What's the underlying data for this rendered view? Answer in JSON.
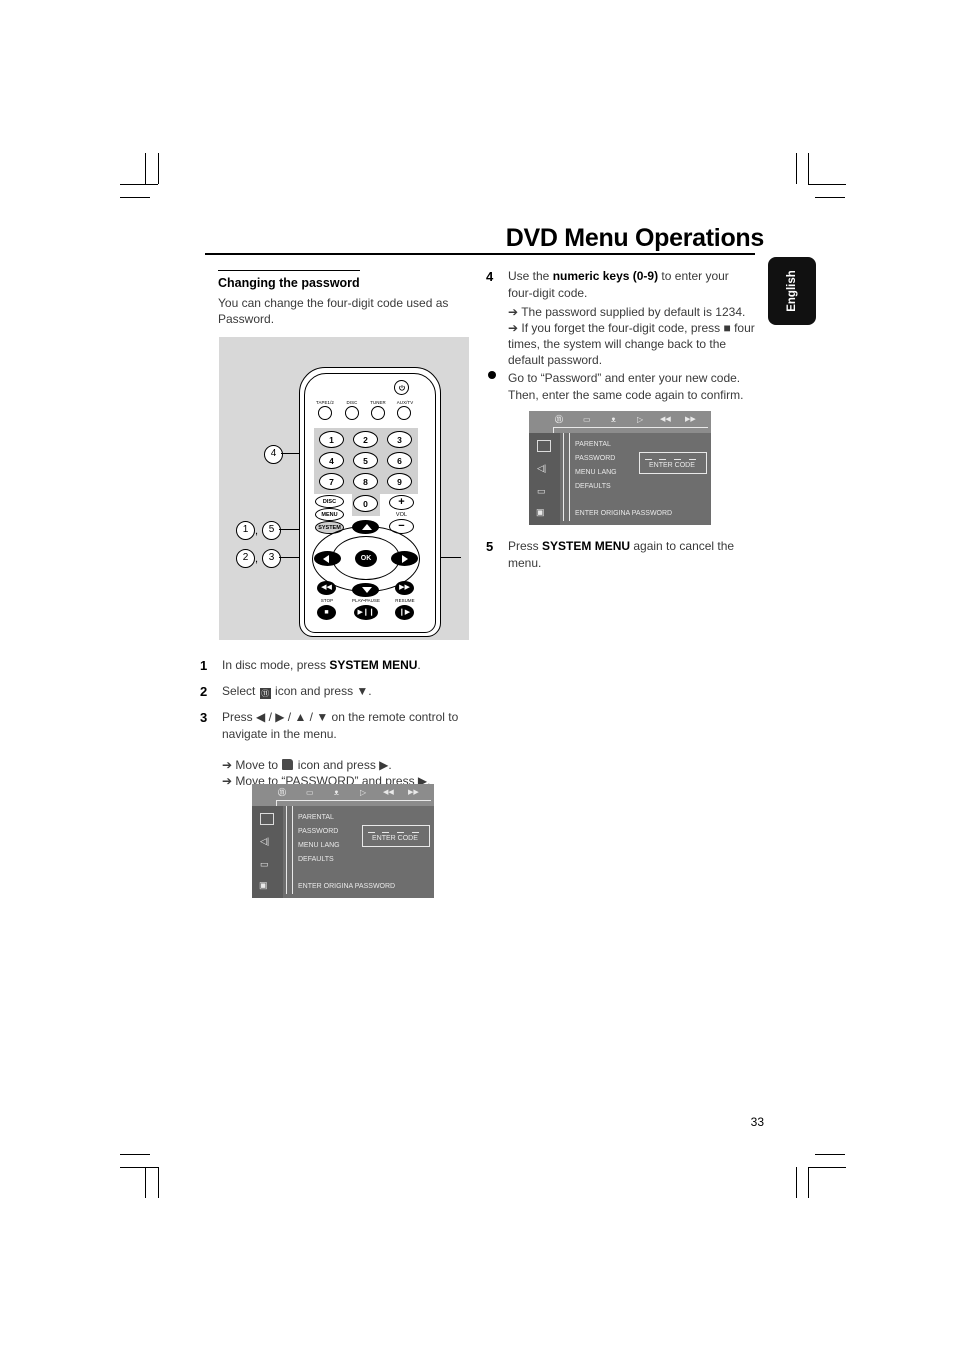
{
  "document": {
    "title": "DVD Menu Operations",
    "language_tab": "English",
    "page_number": "33"
  },
  "left_column": {
    "heading": "Changing the password",
    "intro": "You can change the four-digit code used as Password.",
    "steps": [
      {
        "num": "1",
        "text_before": "In disc mode, press ",
        "bold": "SYSTEM MENU",
        "text_after": "."
      },
      {
        "num": "2",
        "text_before": "Select ",
        "icon": "parental-lock-icon",
        "text_after": " icon and press ▼."
      },
      {
        "num": "3",
        "text_before": "Press ◀ / ▶ / ▲ / ▼ on the remote control to navigate in the menu.",
        "bold": "",
        "text_after": ""
      }
    ],
    "arrow_notes": [
      {
        "prefix": "Move to ",
        "icon": "folder-icon",
        "suffix": " icon and press ▶."
      },
      {
        "prefix": "Move to “PASSWORD” and press ▶.",
        "icon": "",
        "suffix": ""
      }
    ]
  },
  "right_column": {
    "steps": [
      {
        "num": "4",
        "text_before": "Use the ",
        "bold": "numeric keys (0-9)",
        "text_after": " to enter your four-digit code."
      },
      {
        "num": "5",
        "text_before": "Press ",
        "bold": "SYSTEM MENU",
        "text_after": " again to cancel the menu."
      }
    ],
    "arrow_notes": [
      "The password supplied by default is 1234.",
      "If you forget the four-digit code, press ■ four times, the system will change back to the default password."
    ],
    "bullet_notes": [
      "Go to “Password” and enter your new code. Then, enter the same code again to confirm."
    ]
  },
  "remote": {
    "callouts": [
      {
        "label": "4"
      },
      {
        "label": "1"
      },
      {
        "label": "5"
      },
      {
        "label": "2"
      },
      {
        "label": "3"
      }
    ],
    "comma": ",",
    "source_buttons": [
      "TAPE1/2",
      "DISC",
      "TUNER",
      "AUX/TV"
    ],
    "power_icon": "power-icon",
    "numeric_keys": [
      "1",
      "2",
      "3",
      "4",
      "5",
      "6",
      "7",
      "8",
      "9",
      "0"
    ],
    "menu_stack": [
      "DISC",
      "MENU",
      "SYSTEM"
    ],
    "volume_label": "VOL",
    "volume_plus": "+",
    "volume_minus": "−",
    "ok_label": "OK",
    "transport_labels": [
      "STOP",
      "PLAY•PAUSE",
      "RESUME"
    ]
  },
  "tv_menu": {
    "top_icons": [
      "parental-icon",
      "display-icon",
      "audio-icon",
      "play-icon",
      "prev-icon",
      "next-icon"
    ],
    "side_icons": [
      "disc-icon",
      "speaker-icon",
      "subtitle-icon",
      "tv-icon"
    ],
    "menu_items": [
      "PARENTAL",
      "PASSWORD",
      "MENU LANG",
      "DEFAULTS"
    ],
    "enter_code_label": "ENTER CODE",
    "status_text": "ENTER ORIGINA PASSWORD",
    "dash_count": 4,
    "colors": {
      "screen_bg": "#6e6e6e",
      "top_bar": "#8c8c8c",
      "side_bar": "#5b5b5b",
      "text": "#e9e9e9"
    }
  }
}
